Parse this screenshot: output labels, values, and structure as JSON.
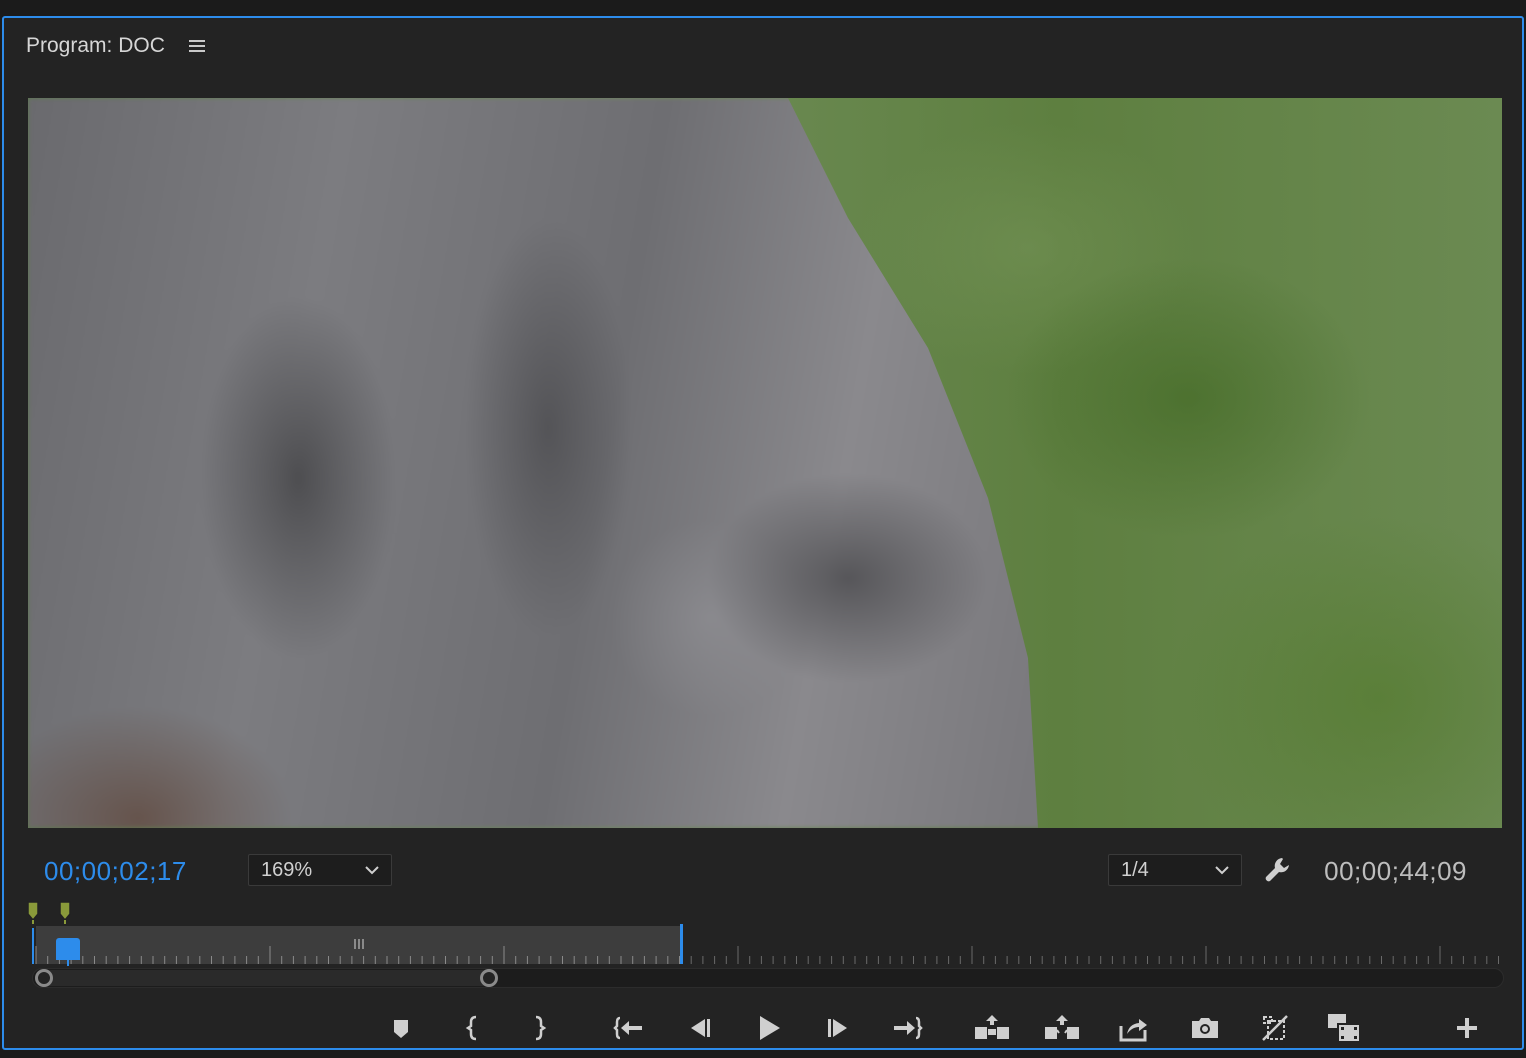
{
  "panel": {
    "title": "Program: DOC",
    "menu_icon": "hamburger-menu-icon"
  },
  "monitor": {
    "current_timecode": "00;00;02;17",
    "duration_timecode": "00;00;44;09",
    "zoom_level": "169%",
    "playback_resolution": "1/4"
  },
  "colors": {
    "accent": "#2d8ceb",
    "panel_bg": "#232323",
    "marker": "#8a9a3a"
  },
  "controls": [
    {
      "name": "add-marker-button",
      "icon": "marker-icon"
    },
    {
      "name": "mark-in-button",
      "icon": "mark-in-icon"
    },
    {
      "name": "mark-out-button",
      "icon": "mark-out-icon"
    },
    {
      "name": "go-to-in-button",
      "icon": "go-to-in-icon"
    },
    {
      "name": "step-back-button",
      "icon": "step-back-icon"
    },
    {
      "name": "play-button",
      "icon": "play-icon"
    },
    {
      "name": "step-forward-button",
      "icon": "step-forward-icon"
    },
    {
      "name": "go-to-out-button",
      "icon": "go-to-out-icon"
    },
    {
      "name": "lift-button",
      "icon": "lift-icon"
    },
    {
      "name": "extract-button",
      "icon": "extract-icon"
    },
    {
      "name": "export-button",
      "icon": "export-icon"
    },
    {
      "name": "export-frame-button",
      "icon": "camera-icon"
    },
    {
      "name": "comparison-view-button",
      "icon": "comparison-view-icon"
    },
    {
      "name": "multi-camera-button",
      "icon": "multi-camera-icon"
    },
    {
      "name": "button-editor-button",
      "icon": "plus-icon"
    }
  ]
}
